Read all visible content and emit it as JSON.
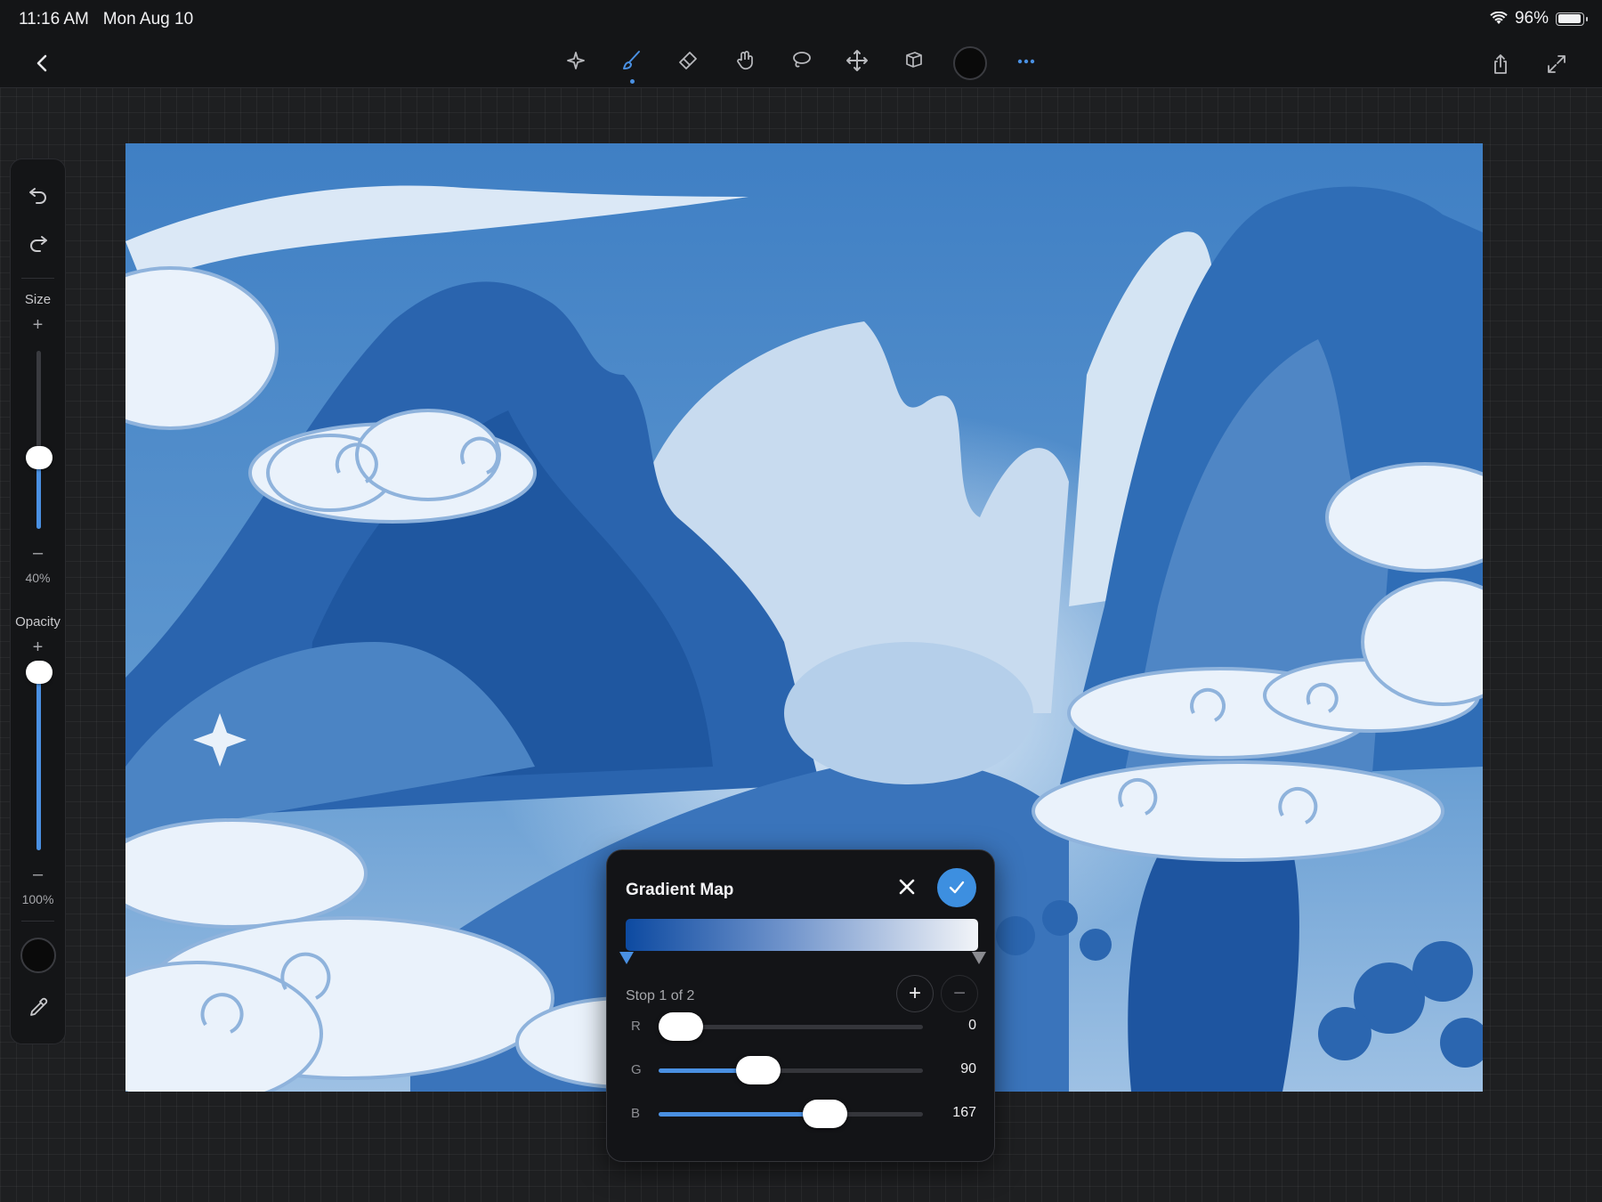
{
  "status_bar": {
    "time": "11:16 AM",
    "date": "Mon Aug 10",
    "battery": "96%",
    "battery_level": 0.96,
    "wifi_icon": "wifi-icon",
    "battery_icon": "battery-icon"
  },
  "toolbar": {
    "back_icon": "chevron-left-icon",
    "tools": [
      "magic-wand-icon",
      "brush-icon",
      "eraser-icon",
      "smudge-icon",
      "lasso-icon",
      "move-icon",
      "layers-icon",
      "color-swatch",
      "more-icon"
    ],
    "active_tool": "brush-icon",
    "current_color": "#0a0a0a",
    "share_icon": "share-icon",
    "fullscreen_icon": "expand-icon"
  },
  "sidebar": {
    "size_label": "Size",
    "size_value": "40%",
    "size_level": 0.4,
    "opacity_label": "Opacity",
    "opacity_value": "100%",
    "opacity_level": 1.0,
    "plus": "+",
    "minus": "–",
    "color": "#0a0a0a"
  },
  "gradient_map": {
    "title": "Gradient Map",
    "stop_label": "Stop 1 of 2",
    "gradient_colors": [
      "#0d4aa1",
      "#f2f4f8"
    ],
    "add_label": "+",
    "remove_label": "−",
    "channels": [
      {
        "label": "R",
        "value": "0",
        "level": 0.0
      },
      {
        "label": "G",
        "value": "90",
        "level": 0.353
      },
      {
        "label": "B",
        "value": "167",
        "level": 0.655
      }
    ]
  },
  "colors": {
    "accent": "#4a90e2",
    "toolbar_bg": "#141517",
    "canvas_blue": "#4683c6"
  }
}
